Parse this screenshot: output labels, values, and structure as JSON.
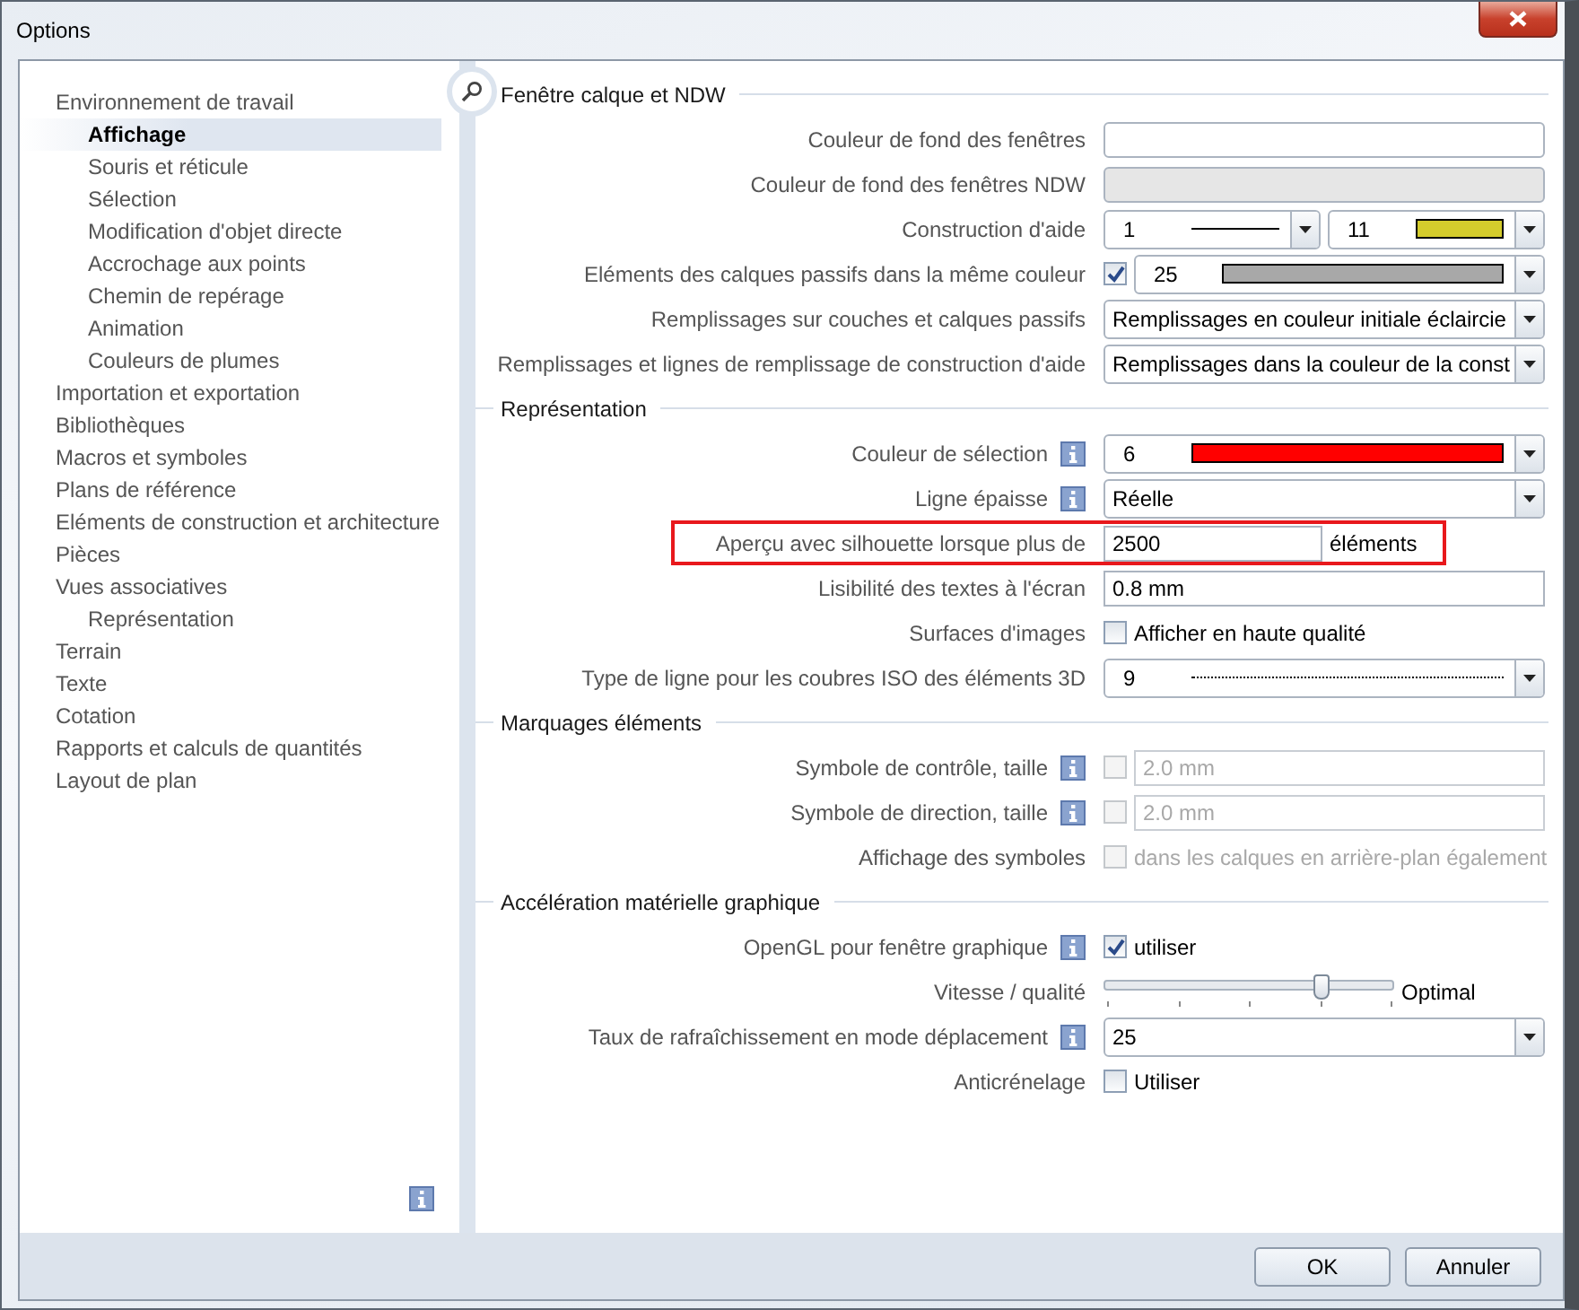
{
  "window": {
    "title": "Options"
  },
  "sidebar": {
    "items": [
      {
        "label": "Environnement de travail",
        "selected": false,
        "children": [
          {
            "label": "Affichage",
            "selected": true
          },
          {
            "label": "Souris et réticule",
            "selected": false
          },
          {
            "label": "Sélection",
            "selected": false
          },
          {
            "label": "Modification d'objet directe",
            "selected": false
          },
          {
            "label": "Accrochage aux points",
            "selected": false
          },
          {
            "label": "Chemin de repérage",
            "selected": false
          },
          {
            "label": "Animation",
            "selected": false
          },
          {
            "label": "Couleurs de plumes",
            "selected": false
          }
        ]
      },
      {
        "label": "Importation et exportation",
        "selected": false
      },
      {
        "label": "Bibliothèques",
        "selected": false
      },
      {
        "label": "Macros et symboles",
        "selected": false
      },
      {
        "label": "Plans de référence",
        "selected": false
      },
      {
        "label": "Eléments de construction et architecture",
        "selected": false
      },
      {
        "label": "Pièces",
        "selected": false
      },
      {
        "label": "Vues associatives",
        "selected": false,
        "children": [
          {
            "label": "Représentation",
            "selected": false
          }
        ]
      },
      {
        "label": "Terrain",
        "selected": false
      },
      {
        "label": "Texte",
        "selected": false
      },
      {
        "label": "Cotation",
        "selected": false
      },
      {
        "label": "Rapports et calculs de quantités",
        "selected": false
      },
      {
        "label": "Layout de plan",
        "selected": false
      }
    ]
  },
  "sections": [
    {
      "title": "Fenêtre calque et NDW",
      "rows": [
        {
          "label": "Couleur de fond des fenêtres",
          "info": false,
          "kind": "color_field",
          "disabled": false
        },
        {
          "label": "Couleur de fond des fenêtres NDW",
          "info": false,
          "kind": "color_field",
          "disabled": true
        },
        {
          "label": "Construction d'aide",
          "info": false,
          "kind": "combos",
          "combos": [
            {
              "value": "1",
              "kind": "line"
            },
            {
              "value": "11",
              "kind": "swatch",
              "color": "#d4cc2c"
            }
          ]
        },
        {
          "label": "Eléments des calques passifs dans la même couleur",
          "info": false,
          "kind": "check_combo",
          "checked": true,
          "combo": {
            "value": "25",
            "kind": "swatch",
            "color": "#a8a8a8"
          }
        },
        {
          "label": "Remplissages sur couches et calques passifs",
          "info": false,
          "kind": "combos",
          "combos": [
            {
              "value": "Remplissages en couleur initiale éclaircie"
            }
          ]
        },
        {
          "label": "Remplissages et lignes de remplissage de construction d'aide",
          "info": false,
          "kind": "combos",
          "combos": [
            {
              "value": "Remplissages dans la couleur de la const"
            }
          ]
        }
      ]
    },
    {
      "title": "Représentation",
      "rows": [
        {
          "label": "Couleur de sélection",
          "info": true,
          "kind": "combos",
          "combos": [
            {
              "value": "6",
              "kind": "swatch",
              "color": "#ff0000"
            }
          ]
        },
        {
          "label": "Ligne épaisse",
          "info": true,
          "kind": "combos",
          "combos": [
            {
              "value": "Réelle"
            }
          ]
        },
        {
          "label": "Aperçu avec silhouette lorsque plus de",
          "info": false,
          "kind": "field",
          "value": "2500",
          "suffix": "éléments",
          "highlighted": true
        },
        {
          "label": "Lisibilité des textes à l'écran",
          "info": false,
          "kind": "field",
          "value": "0.8 mm",
          "highlighted": false
        },
        {
          "label": "Surfaces d'images",
          "info": false,
          "kind": "check",
          "checked": false,
          "disabled": false,
          "text": "Afficher en haute qualité"
        },
        {
          "label": "Type de ligne pour les coubres ISO des éléments 3D",
          "info": false,
          "kind": "combos",
          "combos": [
            {
              "value": "9",
              "kind": "dotted"
            }
          ]
        }
      ]
    },
    {
      "title": "Marquages éléments",
      "rows": [
        {
          "label": "Symbole de contrôle, taille",
          "info": true,
          "kind": "check_field",
          "checked": false,
          "disabled": true,
          "value": "2.0 mm"
        },
        {
          "label": "Symbole de direction, taille",
          "info": true,
          "kind": "check_field",
          "checked": false,
          "disabled": true,
          "value": "2.0 mm"
        },
        {
          "label": "Affichage des symboles",
          "info": false,
          "kind": "check",
          "checked": false,
          "disabled": true,
          "text": "dans les calques en arrière-plan également"
        }
      ]
    },
    {
      "title": "Accélération matérielle graphique",
      "rows": [
        {
          "label": "OpenGL pour fenêtre graphique",
          "info": true,
          "kind": "check",
          "checked": true,
          "disabled": false,
          "text": "utiliser"
        },
        {
          "label": "Vitesse / qualité",
          "info": false,
          "kind": "slider",
          "level": 0.75,
          "text": "Optimal"
        },
        {
          "label": "Taux de rafraîchissement en mode déplacement",
          "info": true,
          "kind": "combos",
          "combos": [
            {
              "value": "25"
            }
          ]
        },
        {
          "label": "Anticrénelage",
          "info": false,
          "kind": "check",
          "checked": false,
          "disabled": false,
          "text": "Utiliser"
        }
      ]
    }
  ],
  "buttons": [
    "OK",
    "Annuler"
  ]
}
